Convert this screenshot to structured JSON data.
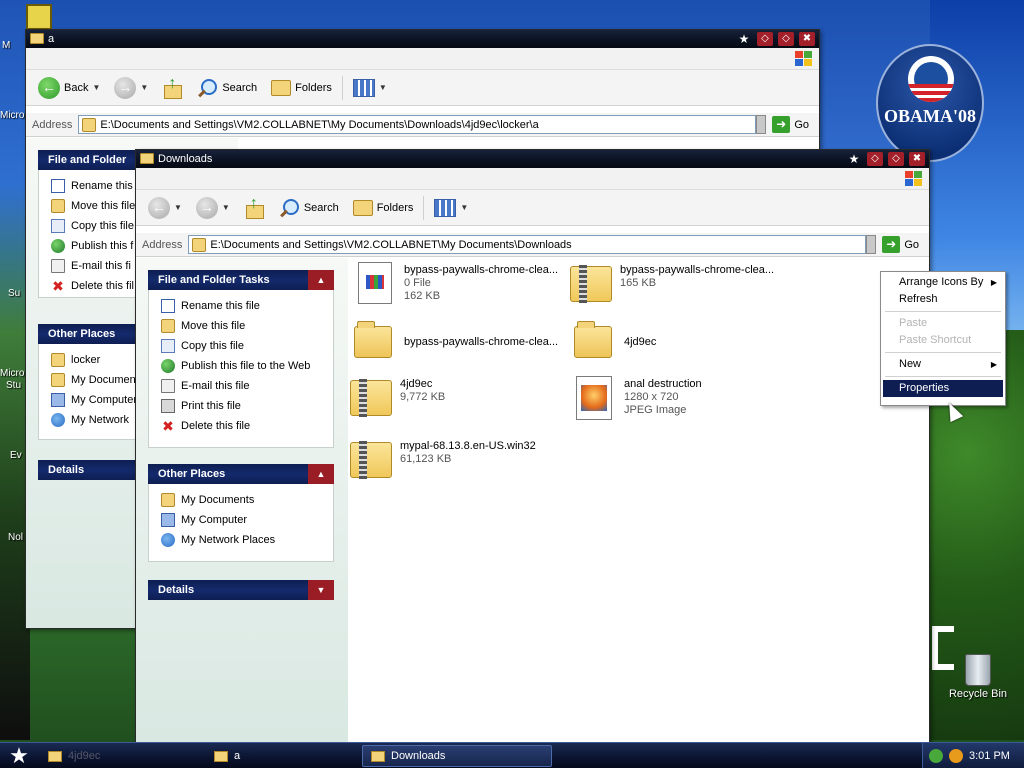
{
  "desktop": {
    "left_labels": [
      "M",
      "Micro",
      "Su",
      "Micro",
      "Stu",
      "Ev",
      "Nol"
    ],
    "recycle_bin_label": "Recycle Bin",
    "wallpaper_logo_text": "OBAMA'08"
  },
  "back_window": {
    "title": "a",
    "toolbar": {
      "back": "Back",
      "search": "Search",
      "folders": "Folders"
    },
    "address": {
      "label": "Address",
      "path": "E:\\Documents and Settings\\VM2.COLLABNET\\My Documents\\Downloads\\4jd9ec\\locker\\a",
      "go": "Go"
    },
    "file_tasks": {
      "header": "File and Folder",
      "items": [
        "Rename this",
        "Move this file",
        "Copy this file",
        "Publish this f",
        "E-mail this fi",
        "Delete this fil"
      ]
    },
    "other_places": {
      "header": "Other Places",
      "items": [
        "locker",
        "My Documen",
        "My Computer",
        "My Network"
      ]
    },
    "details": {
      "header": "Details"
    }
  },
  "front_window": {
    "title": "Downloads",
    "toolbar": {
      "search": "Search",
      "folders": "Folders"
    },
    "address": {
      "label": "Address",
      "path": "E:\\Documents and Settings\\VM2.COLLABNET\\My Documents\\Downloads",
      "go": "Go"
    },
    "file_tasks": {
      "header": "File and Folder Tasks",
      "items": [
        "Rename this file",
        "Move this file",
        "Copy this file",
        "Publish this file to the Web",
        "E-mail this file",
        "Print this file",
        "Delete this file"
      ]
    },
    "other_places": {
      "header": "Other Places",
      "items": [
        "My Documents",
        "My Computer",
        "My Network Places"
      ]
    },
    "details": {
      "header": "Details"
    },
    "files": [
      {
        "name": "bypass-paywalls-chrome-clea...",
        "line2": "0 File",
        "line3": "162 KB",
        "icon": "document-icon"
      },
      {
        "name": "bypass-paywalls-chrome-clea...",
        "line2": "165 KB",
        "line3": "",
        "icon": "zip-folder-icon"
      },
      {
        "name": "bypass-paywalls-chrome-clea...",
        "line2": "",
        "line3": "",
        "icon": "folder-icon"
      },
      {
        "name": "4jd9ec",
        "line2": "",
        "line3": "",
        "icon": "folder-icon"
      },
      {
        "name": "4jd9ec",
        "line2": "9,772 KB",
        "line3": "",
        "icon": "zip-folder-icon"
      },
      {
        "name": "anal destruction",
        "line2": "1280 x 720",
        "line3": "JPEG Image",
        "icon": "jpeg-image-icon"
      },
      {
        "name": "mypal-68.13.8.en-US.win32",
        "line2": "61,123 KB",
        "line3": "",
        "icon": "zip-folder-icon"
      }
    ]
  },
  "context_menu": {
    "items": [
      {
        "label": "Arrange Icons By",
        "enabled": true,
        "submenu": true
      },
      {
        "label": "Refresh",
        "enabled": true,
        "submenu": false
      },
      {
        "label": "Paste",
        "enabled": false,
        "submenu": false
      },
      {
        "label": "Paste Shortcut",
        "enabled": false,
        "submenu": false
      },
      {
        "label": "New",
        "enabled": true,
        "submenu": true
      },
      {
        "label": "Properties",
        "enabled": true,
        "submenu": false,
        "highlighted": true
      }
    ]
  },
  "taskbar": {
    "tasks": [
      {
        "label": "4jd9ec",
        "active": false
      },
      {
        "label": "a",
        "active": false
      },
      {
        "label": "Downloads",
        "active": true
      }
    ],
    "clock": "3:01 PM"
  },
  "colors": {
    "titlebar": "#0b1222",
    "taskpane_header": "#142a6c",
    "taskpane_accent_red": "#9a1c24",
    "selection": "#0e1e52"
  }
}
